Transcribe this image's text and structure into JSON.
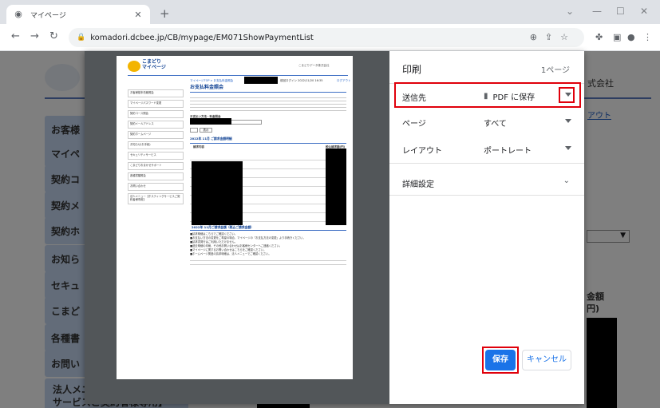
{
  "browser": {
    "tab_title": "マイページ",
    "tab_favicon": "globe-icon",
    "url": "komadori.dcbee.jp/CB/mypage/EM071ShowPaymentList"
  },
  "site": {
    "company_tail": "式会社",
    "logout_tail": "アウト",
    "sidebar": [
      {
        "label": "お客様"
      },
      {
        "label": "マイペ"
      },
      {
        "label": "契約コ"
      },
      {
        "label": "契約メ"
      },
      {
        "label": "契約ホ"
      },
      {
        "label": "お知ら"
      },
      {
        "label": "セキュ"
      },
      {
        "label": "こまど"
      },
      {
        "label": "各種書"
      },
      {
        "label": "お問い"
      },
      {
        "label": "法人メニュー【ホスティングサービスご契約者様専用】"
      }
    ],
    "table_header": "金額\n円)"
  },
  "print_dialog": {
    "title": "印刷",
    "page_count": "1ページ",
    "destination_label": "送信先",
    "destination_value": "PDF に保存",
    "pages_label": "ページ",
    "pages_value": "すべて",
    "layout_label": "レイアウト",
    "layout_value": "ポートレート",
    "more_settings": "詳細設定",
    "save_button": "保存",
    "cancel_button": "キャンセル"
  },
  "preview": {
    "logo_text": "こまどり\nマイページ",
    "company_small": "こまどりデータ株式会社",
    "breadcrumb": "マイページTOP > お支払料金照会",
    "login_info": "前回ログイン 2022/11/20 16:35",
    "logout_small": "ログアウト",
    "page_heading": "お支払料金照会",
    "menu": [
      "お客様基本情報照会",
      "マイページパスワード変更",
      "契約コース照会",
      "契約メールアドレス",
      "契約ホームページ",
      "お知らせ(お手紙)",
      "セキュリティサービス",
      "こまどりおまかせサポート",
      "各種書類照会",
      "お問い合わせ",
      "法人メニュー【ホスティングサービスご契約者様専用】"
    ],
    "select_caption": "お支払い方法・料金照会",
    "show_button": "表示",
    "month_title": "2022年 11月 ご請求金額明細",
    "col_name": "請求内容",
    "col_amount": "税込請求額(円)",
    "total_title": "2022年 11月ご請求金額（税込ご請求金額）",
    "notes": [
      "■請求明細はこちらでご確認ください。",
      "■お支払い方法の変更をご希望の場合、マイページの「お支払方法の変更」より手続きください。",
      "■請求書発行はご利用いただけません。",
      "■過去明細の印刷、その他お問い合わせはお客様センターへご連絡ください。",
      "■マイページに関するお問い合わせはこちらをご確認ください。",
      "■ホームページ関連の請求明細は、法人メニューでご確認ください。"
    ]
  }
}
